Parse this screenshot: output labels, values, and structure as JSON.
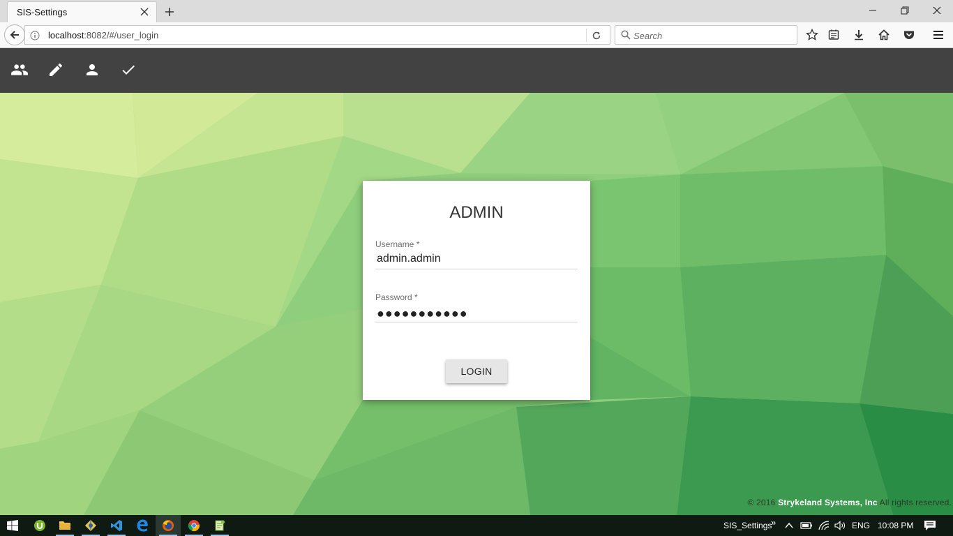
{
  "browser": {
    "tab_title": "SIS-Settings",
    "url_host": "localhost",
    "url_rest": ":8082/#/user_login",
    "search_placeholder": "Search"
  },
  "app": {
    "toolbar_icons": [
      "people-icon",
      "pencil-icon",
      "person-icon",
      "check-icon"
    ]
  },
  "login": {
    "title": "ADMIN",
    "username_label": "Username *",
    "username_value": "admin.admin",
    "password_label": "Password *",
    "password_value": "●●●●●●●●●●●",
    "login_button": "LOGIN"
  },
  "footer": {
    "copyright_prefix": "© 2016",
    "company": "Strykeland Systems, Inc",
    "rights": "All rights reserved."
  },
  "taskbar": {
    "running_label": "SIS_Settings",
    "chevron": "»",
    "language": "ENG",
    "time": "10:08 PM"
  },
  "colors": {
    "appbar": "#424242",
    "taskbar": "#0f1a12",
    "background_light": "#dfeea0",
    "background_dark": "#2a8d45"
  }
}
